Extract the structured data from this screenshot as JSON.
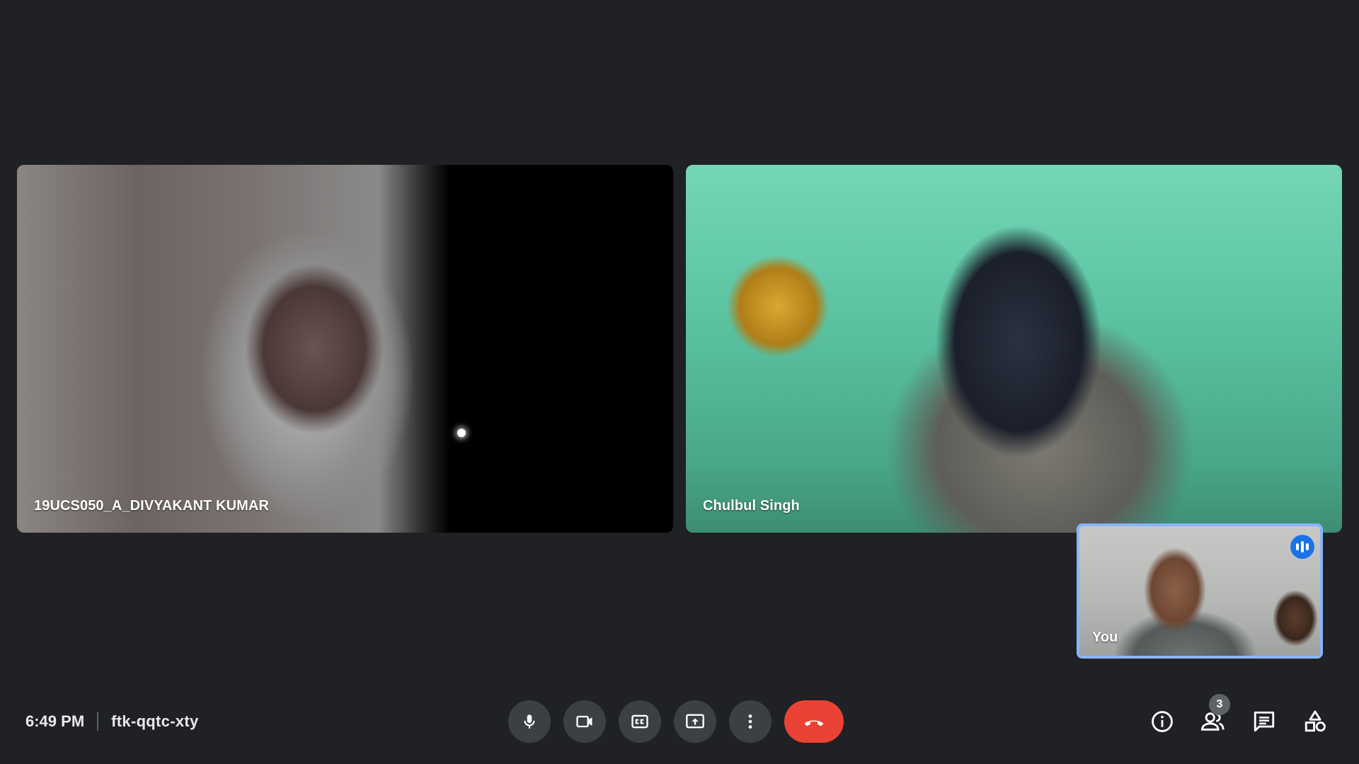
{
  "participants": [
    {
      "name": "19UCS050_A_DIVYAKANT KUMAR"
    },
    {
      "name": "Chulbul Singh"
    }
  ],
  "self_view": {
    "name": "You",
    "speaking_icon": "audio-level-icon"
  },
  "meeting": {
    "time": "6:49 PM",
    "code": "ftk-qqtc-xty"
  },
  "controls": [
    {
      "icon": "microphone-icon"
    },
    {
      "icon": "camera-icon"
    },
    {
      "icon": "captions-icon"
    },
    {
      "icon": "present-screen-icon"
    },
    {
      "icon": "more-options-icon"
    },
    {
      "icon": "end-call-icon"
    }
  ],
  "right_panel": {
    "people_count": "3",
    "icons": [
      "info-icon",
      "people-icon",
      "chat-icon",
      "activities-icon"
    ]
  },
  "colors": {
    "background": "#202124",
    "control_button": "#3c4043",
    "end_call": "#ea4335",
    "self_view_border": "#8ab4f8",
    "speaking_indicator": "#1a73e8"
  }
}
